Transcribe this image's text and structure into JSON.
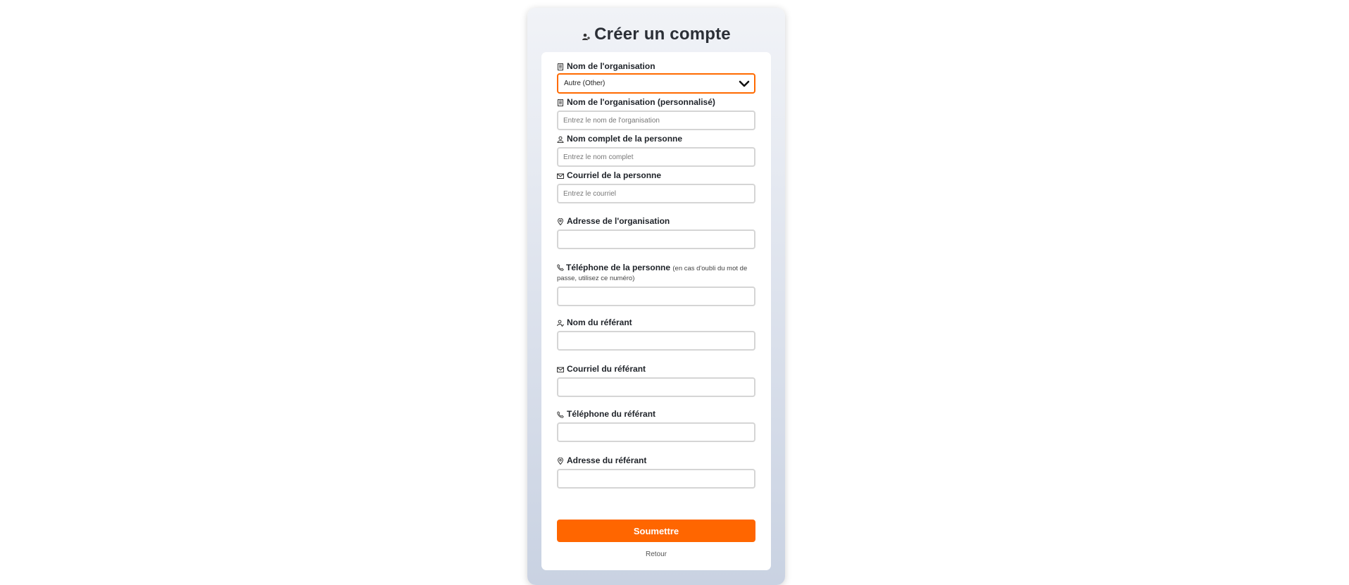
{
  "page": {
    "title": "Créer un compte",
    "title_icon": "user-add-icon"
  },
  "form": {
    "org_select": {
      "label": "Nom de l'organisation",
      "icon": "building-icon",
      "value": "Autre (Other)"
    },
    "org_custom": {
      "label": "Nom de l'organisation (personnalisé)",
      "icon": "building-icon",
      "placeholder": "Entrez le nom de l'organisation"
    },
    "full_name": {
      "label": "Nom complet de la personne",
      "icon": "user-icon",
      "placeholder": "Entrez le nom complet"
    },
    "email": {
      "label": "Courriel de la personne",
      "icon": "mail-icon",
      "placeholder": "Entrez le courriel"
    },
    "org_address": {
      "label": "Adresse de l'organisation",
      "icon": "location-pin-icon"
    },
    "phone": {
      "label": "Téléphone de la personne",
      "hint": "(en cas d'oubli du mot de passe, utilisez ce numéro)",
      "icon": "phone-icon"
    },
    "referrer_name": {
      "label": "Nom du référant",
      "icon": "user-check-icon"
    },
    "referrer_email": {
      "label": "Courriel du référant",
      "icon": "mail-icon"
    },
    "referrer_phone": {
      "label": "Téléphone du référant",
      "icon": "phone-icon"
    },
    "referrer_address": {
      "label": "Adresse du référant",
      "icon": "location-pin-icon"
    }
  },
  "actions": {
    "submit_label": "Soumettre",
    "back_label": "Retour"
  },
  "colors": {
    "accent": "#ff6600",
    "select_border": "#ff6a00"
  }
}
